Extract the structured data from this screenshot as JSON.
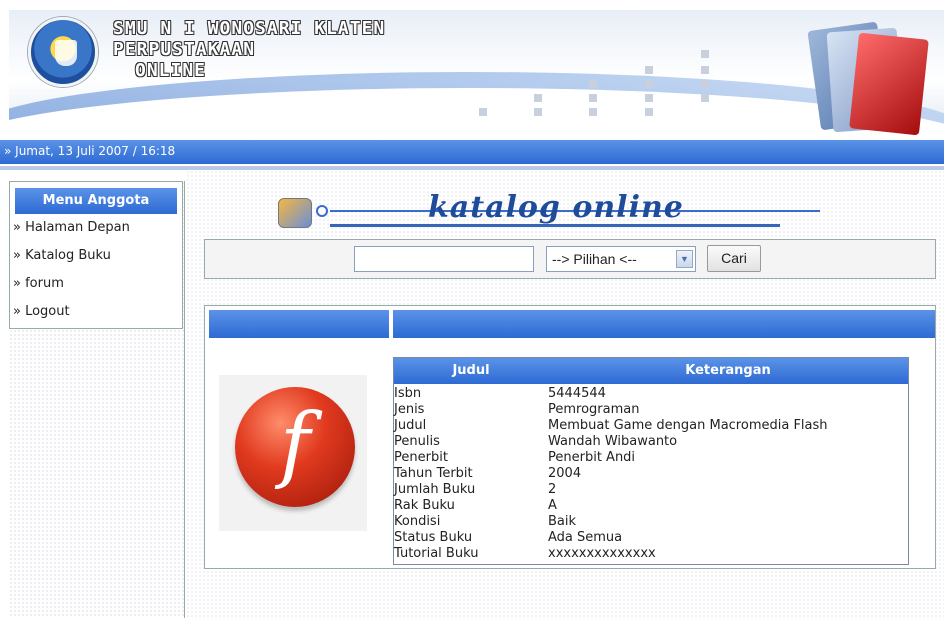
{
  "header": {
    "title_lines": [
      "SMU N I WONOSARI KLATEN",
      "PERPUSTAKAAN",
      "ONLINE"
    ]
  },
  "datebar": {
    "text": "» Jumat, 13 Juli 2007 / 16:18"
  },
  "sidebar": {
    "title": "Menu Anggota",
    "items": [
      {
        "label": "» Halaman Depan"
      },
      {
        "label": "» Katalog Buku"
      },
      {
        "label": "» forum"
      },
      {
        "label": "» Logout"
      }
    ]
  },
  "main": {
    "banner_title": "katalog online",
    "search": {
      "input_value": "",
      "select_value": "--> Pilihan <--",
      "button_label": "Cari"
    },
    "detail": {
      "header": {
        "col1": "Judul",
        "col2": "Keterangan"
      },
      "rows": [
        {
          "key": "Isbn",
          "value": "5444544"
        },
        {
          "key": "Jenis",
          "value": "Pemrograman"
        },
        {
          "key": "Judul",
          "value": "Membuat Game dengan Macromedia Flash"
        },
        {
          "key": "Penulis",
          "value": "Wandah Wibawanto"
        },
        {
          "key": "Penerbit",
          "value": "Penerbit Andi"
        },
        {
          "key": "Tahun Terbit",
          "value": "2004"
        },
        {
          "key": "Jumlah Buku",
          "value": "2"
        },
        {
          "key": "Rak Buku",
          "value": "A"
        },
        {
          "key": "Kondisi",
          "value": "Baik"
        },
        {
          "key": "Status Buku",
          "value": "Ada Semua"
        },
        {
          "key": "Tutorial Buku",
          "value": "xxxxxxxxxxxxxx"
        }
      ],
      "cover_icon": "flash-logo-icon",
      "cover_letter": "f"
    }
  },
  "colors": {
    "accent": "#2d6ad3",
    "title_blue": "#1f4c9a",
    "flash_red": "#e13a1f"
  }
}
